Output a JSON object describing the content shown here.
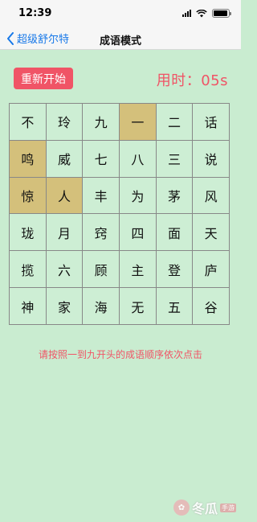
{
  "status_bar": {
    "time": "12:39"
  },
  "nav": {
    "back_label": "超级舒尔特",
    "title": "成语模式"
  },
  "controls": {
    "restart_label": "重新开始",
    "timer": "用时：05s"
  },
  "grid": [
    [
      "不",
      "玲",
      "九",
      "一",
      "二",
      "话"
    ],
    [
      "鸣",
      "威",
      "七",
      "八",
      "三",
      "说"
    ],
    [
      "惊",
      "人",
      "丰",
      "为",
      "茅",
      "风"
    ],
    [
      "珑",
      "月",
      "窍",
      "四",
      "面",
      "天"
    ],
    [
      "揽",
      "六",
      "顾",
      "主",
      "登",
      "庐"
    ],
    [
      "神",
      "家",
      "海",
      "无",
      "五",
      "谷"
    ]
  ],
  "selected": [
    "0-3",
    "1-0",
    "2-0",
    "2-1"
  ],
  "hint": "请按照一到九开头的成语顺序依次点击",
  "watermark": {
    "brand": "冬瓜",
    "sub": "手游"
  },
  "colors": {
    "accent": "#f05466",
    "background": "#c9ecd0",
    "selected": "#d4c07b",
    "link": "#1778e8"
  }
}
